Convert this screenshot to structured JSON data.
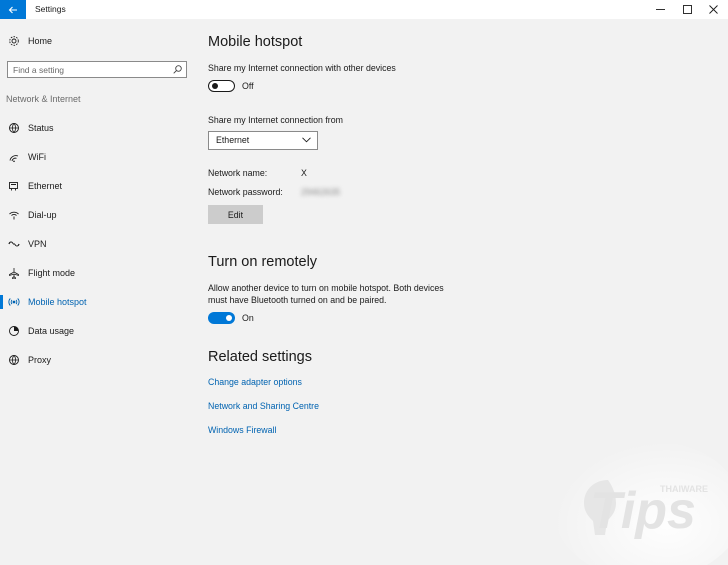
{
  "window": {
    "title": "Settings",
    "controls": {
      "minimize": "─",
      "maximize": "☐",
      "close": "✕"
    }
  },
  "sidebar": {
    "home_label": "Home",
    "search": {
      "placeholder": "Find a setting",
      "value": ""
    },
    "section_heading": "Network & Internet",
    "items": [
      {
        "label": "Status",
        "icon": "globe-status-icon"
      },
      {
        "label": "WiFi",
        "icon": "wifi-icon"
      },
      {
        "label": "Ethernet",
        "icon": "ethernet-icon"
      },
      {
        "label": "Dial-up",
        "icon": "dialup-icon"
      },
      {
        "label": "VPN",
        "icon": "vpn-icon"
      },
      {
        "label": "Flight mode",
        "icon": "airplane-icon"
      },
      {
        "label": "Mobile hotspot",
        "icon": "hotspot-icon",
        "active": true
      },
      {
        "label": "Data usage",
        "icon": "data-usage-icon"
      },
      {
        "label": "Proxy",
        "icon": "globe-icon"
      }
    ]
  },
  "main": {
    "hotspot": {
      "title": "Mobile hotspot",
      "share_label": "Share my Internet connection with other devices",
      "share_toggle": {
        "state": "Off",
        "on": false
      },
      "share_from_label": "Share my Internet connection from",
      "share_from_value": "Ethernet",
      "network_name_label": "Network name:",
      "network_name_value": "X",
      "network_password_label": "Network password:",
      "network_password_value": "29462635",
      "edit_label": "Edit"
    },
    "remote": {
      "title": "Turn on remotely",
      "description_line1": "Allow another device to turn on mobile hotspot. Both devices",
      "description_line2": "must have Bluetooth turned on and be paired.",
      "toggle": {
        "state": "On",
        "on": true
      }
    },
    "related": {
      "title": "Related settings",
      "links": [
        "Change adapter options",
        "Network and Sharing Centre",
        "Windows Firewall"
      ]
    }
  },
  "watermark": {
    "brand": "THAIWARE",
    "word": "Tips"
  },
  "colors": {
    "accent": "#0078d7",
    "link": "#0063b1",
    "background": "#f2f2f2"
  }
}
